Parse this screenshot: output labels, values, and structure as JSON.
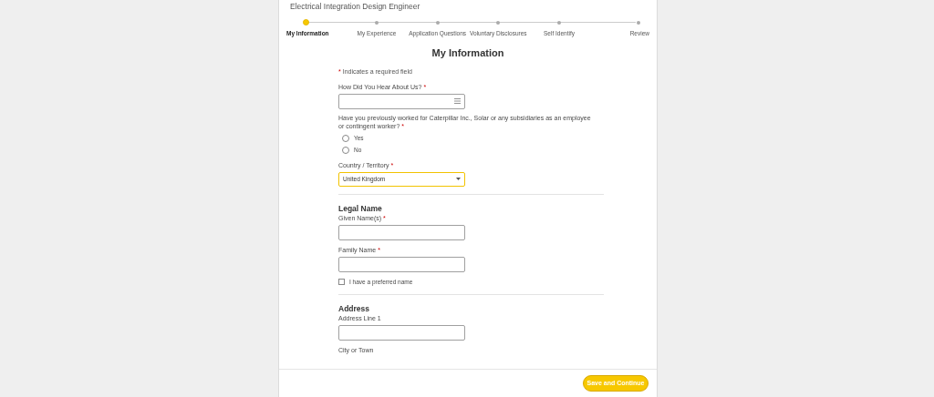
{
  "job_title": "Electrical Integration Design Engineer",
  "steps": [
    {
      "label": "My Information",
      "selected": true
    },
    {
      "label": "My Experience",
      "selected": false
    },
    {
      "label": "Application Questions",
      "selected": false
    },
    {
      "label": "Voluntary Disclosures",
      "selected": false
    },
    {
      "label": "Self Identify",
      "selected": false
    },
    {
      "label": "Review",
      "selected": false
    }
  ],
  "heading": "My Information",
  "required_note": {
    "mark": "*",
    "text": "Indicates a required field"
  },
  "sections": [
    {
      "fields": [
        {
          "kind": "prompt",
          "label": "How Did You Hear About Us?",
          "required": true
        },
        {
          "kind": "radio",
          "label": "Have you previously worked for Caterpillar Inc., Solar or any subsidiaries as an employee or contingent worker?",
          "required": true,
          "options": [
            {
              "label": "Yes",
              "selected": false
            },
            {
              "label": "No",
              "selected": false
            }
          ]
        },
        {
          "kind": "select",
          "label": "Country / Territory",
          "required": true,
          "value": "United Kingdom",
          "focused": true
        }
      ]
    },
    {
      "title": "Legal Name",
      "fields": [
        {
          "kind": "text",
          "label": "Given Name(s)",
          "required": true
        },
        {
          "kind": "text",
          "label": "Family Name",
          "required": true
        },
        {
          "kind": "checkbox",
          "label": "I have a preferred name",
          "checked": false
        }
      ]
    },
    {
      "title": "Address",
      "fields": [
        {
          "kind": "text",
          "label": "Address Line 1",
          "required": false
        },
        {
          "kind": "label",
          "label": "City or Town",
          "required": false
        }
      ]
    }
  ],
  "footer": {
    "button": "Save and Continue"
  }
}
